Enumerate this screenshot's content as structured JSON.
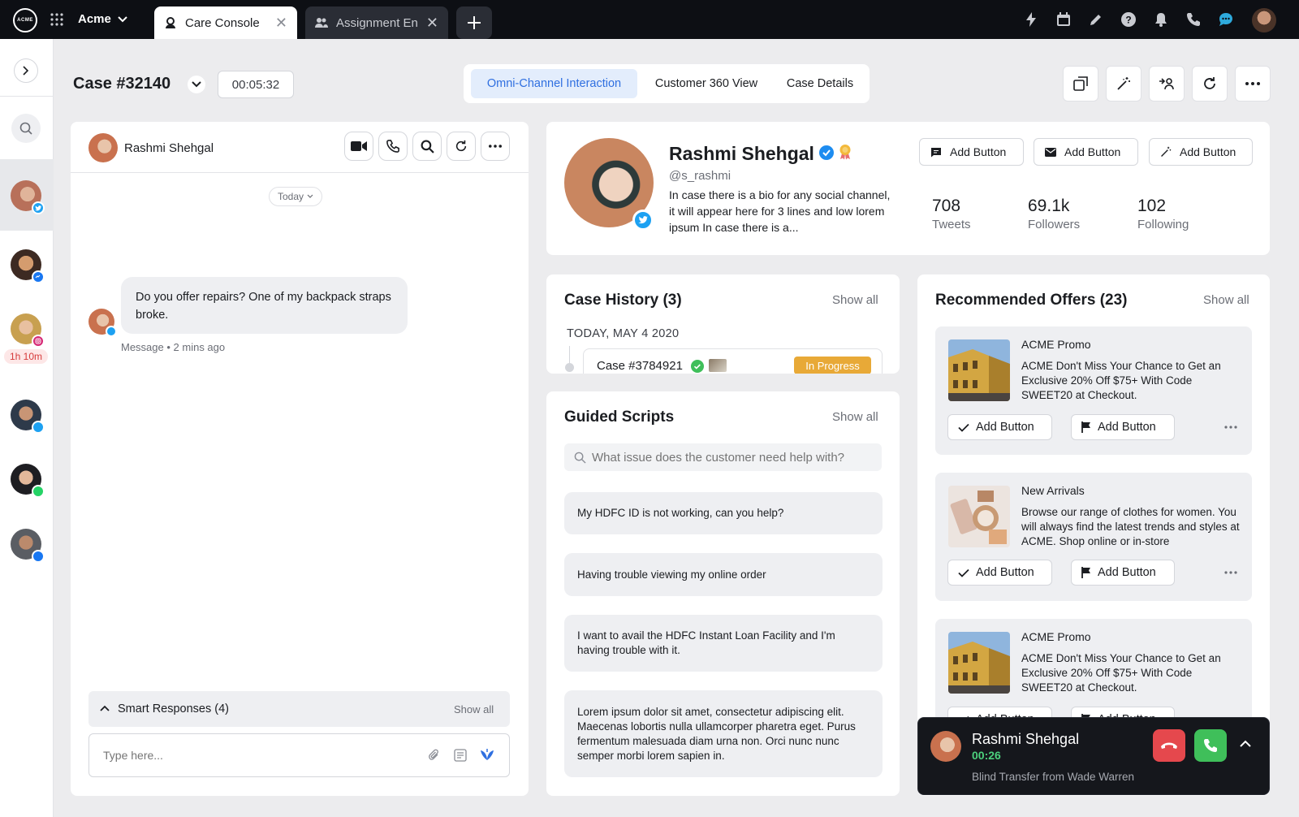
{
  "topbar": {
    "logo_text": "ACME",
    "workspace": "Acme",
    "tabs": [
      {
        "label": "Care Console",
        "active": true
      },
      {
        "label": "Assignment En",
        "active": false
      }
    ]
  },
  "case": {
    "title": "Case #32140",
    "timer": "00:05:32",
    "view_tabs": [
      "Omni-Channel Interaction",
      "Customer 360 View",
      "Case Details"
    ],
    "active_view_tab": "Omni-Channel Interaction"
  },
  "rail": {
    "badge_time": "1h 10m"
  },
  "conversation": {
    "contact_name": "Rashmi Shehgal",
    "date_divider": "Today",
    "message": {
      "text": "Do you offer repairs? One of my backpack straps broke.",
      "meta": "Message • 2 mins ago"
    },
    "smart_responses": {
      "label": "Smart Responses (4)",
      "show_all": "Show all"
    },
    "composer_placeholder": "Type here..."
  },
  "profile": {
    "name": "Rashmi Shehgal",
    "handle": "@s_rashmi",
    "bio": "In case there is a bio for any social channel, it will appear here for 3 lines and low lorem ipsum In case there is a...",
    "buttons": [
      "Add Button",
      "Add Button",
      "Add Button"
    ],
    "stats": [
      {
        "value": "708",
        "label": "Tweets"
      },
      {
        "value": "69.1k",
        "label": "Followers"
      },
      {
        "value": "102",
        "label": "Following"
      }
    ]
  },
  "case_history": {
    "title": "Case History (3)",
    "show_all": "Show all",
    "date": "TODAY, MAY 4 2020",
    "items": [
      {
        "case": "Case #3784921",
        "status": "In Progress"
      }
    ]
  },
  "guided_scripts": {
    "title": "Guided Scripts",
    "show_all": "Show all",
    "search_placeholder": "What issue does the customer need help with?",
    "items": [
      "My HDFC ID is not working, can you help?",
      "Having trouble viewing my online order",
      "I want to avail the HDFC Instant Loan Facility and I'm having trouble with it.",
      "Lorem ipsum dolor sit amet, consectetur adipiscing elit. Maecenas lobortis nulla ullamcorper pharetra eget. Purus fermentum malesuada diam urna non. Orci nunc nunc semper morbi lorem sapien in."
    ]
  },
  "offers": {
    "title": "Recommended Offers (23)",
    "show_all": "Show all",
    "items": [
      {
        "title": "ACME Promo",
        "text": "ACME Don't Miss Your Chance to Get an Exclusive 20% Off $75+ With Code SWEET20 at Checkout.",
        "btn1": "Add Button",
        "btn2": "Add Button"
      },
      {
        "title": "New Arrivals",
        "text": "Browse our range of clothes for women. You will always find the latest trends and styles at ACME. Shop online or in-store",
        "btn1": "Add Button",
        "btn2": "Add Button"
      },
      {
        "title": "ACME Promo",
        "text": "ACME Don't Miss Your Chance to Get an Exclusive 20% Off $75+ With Code SWEET20 at Checkout.",
        "btn1": "Add Button",
        "btn2": "Add Button"
      }
    ]
  },
  "call_popup": {
    "name": "Rashmi Shehgal",
    "duration": "00:26",
    "note": "Blind Transfer from Wade Warren"
  },
  "colors": {
    "accent": "#2f6fe0",
    "twitter": "#1da1f2",
    "in_progress": "#e8a937",
    "decline": "#e5484d",
    "accept": "#3fbf5a",
    "timer_green": "#4cd07d"
  }
}
